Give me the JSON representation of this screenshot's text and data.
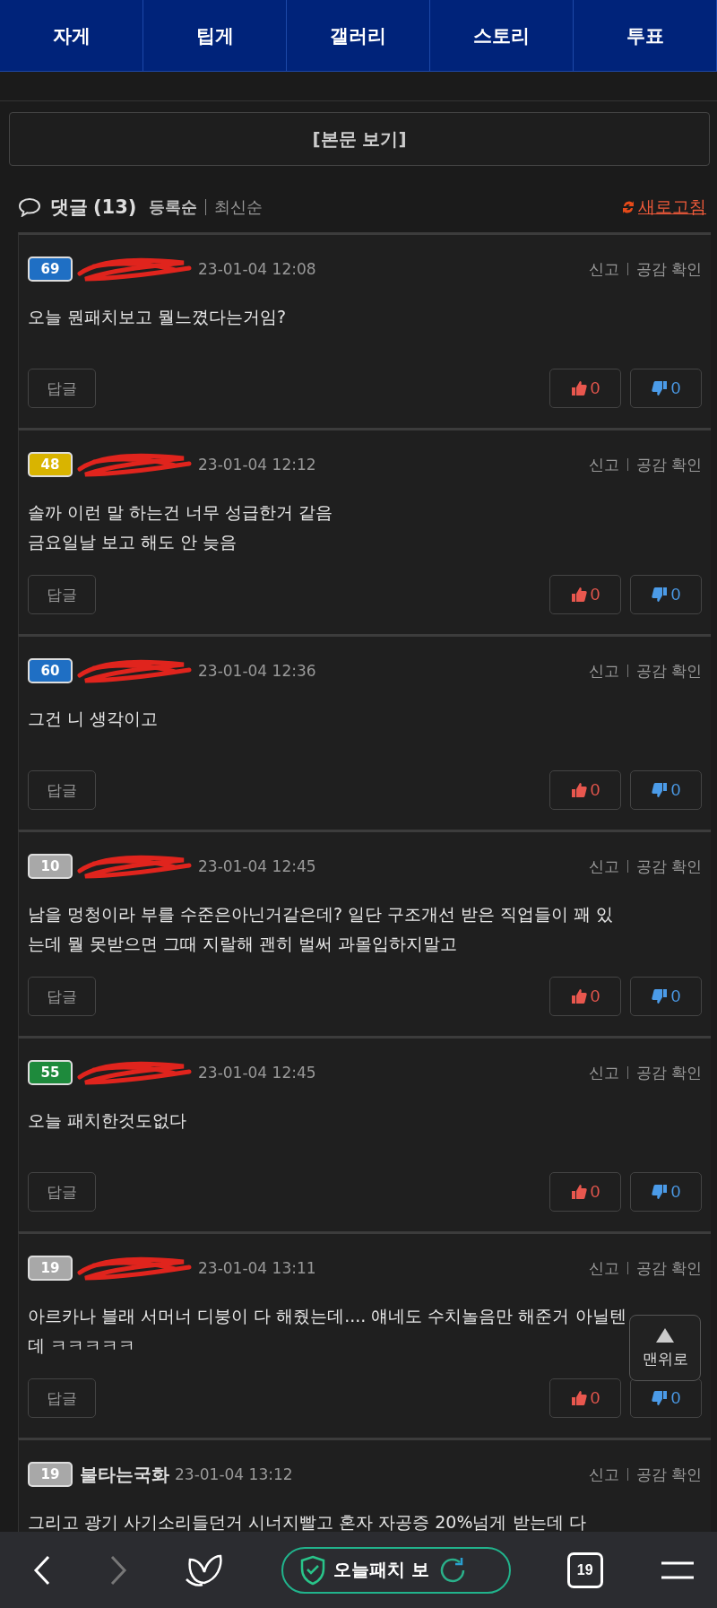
{
  "tabs": [
    {
      "label": "자게",
      "selected": false
    },
    {
      "label": "팁게",
      "selected": false
    },
    {
      "label": "갤러리",
      "selected": false
    },
    {
      "label": "스토리",
      "selected": false
    },
    {
      "label": "투표",
      "selected": false
    }
  ],
  "view_button": "[본문 보기]",
  "comments_header": {
    "title": "댓글",
    "count": "(13)",
    "sorts": [
      {
        "label": "등록순",
        "selected": true
      },
      {
        "label": "최신순",
        "selected": false
      }
    ],
    "refresh": "새로고침"
  },
  "comments": [
    {
      "level": "69",
      "color": "#1f6fc4",
      "redacted": true,
      "date": "23-01-04 12:08",
      "text": "오늘 뭔패치보고 뭘느꼈다는거임?",
      "report": "신고",
      "empathy": "공감 확인",
      "reply": "답글",
      "likes": "0",
      "dislikes": "0"
    },
    {
      "level": "48",
      "color": "#d9b400",
      "redacted": true,
      "date": "23-01-04 12:12",
      "text": "솔까 이런 말 하는건 너무 성급한거 같음\n금요일날 보고 해도 안 늦음",
      "report": "신고",
      "empathy": "공감 확인",
      "reply": "답글",
      "likes": "0",
      "dislikes": "0"
    },
    {
      "level": "60",
      "color": "#1f6fc4",
      "redacted": true,
      "date": "23-01-04 12:36",
      "text": "그건 니 생각이고",
      "report": "신고",
      "empathy": "공감 확인",
      "reply": "답글",
      "likes": "0",
      "dislikes": "0"
    },
    {
      "level": "10",
      "color": "#a8a8a8",
      "redacted": true,
      "date": "23-01-04 12:45",
      "text": "남을 멍청이라 부를 수준은아닌거같은데? 일단 구조개선 받은 직업들이 꽤 있는데 뭘 못받으면 그때 지랄해 괜히 벌써 과몰입하지말고",
      "report": "신고",
      "empathy": "공감 확인",
      "reply": "답글",
      "likes": "0",
      "dislikes": "0"
    },
    {
      "level": "55",
      "color": "#1e8a3c",
      "redacted": true,
      "date": "23-01-04 12:45",
      "text": "오늘 패치한것도없다",
      "report": "신고",
      "empathy": "공감 확인",
      "reply": "답글",
      "likes": "0",
      "dislikes": "0"
    },
    {
      "level": "19",
      "color": "#a8a8a8",
      "redacted": true,
      "date": "23-01-04 13:11",
      "text": "아르카나 블래 서머너 디붕이 다 해줬는데.... 얘네도 수치놀음만 해준거 아닐텐데 ㅋㅋㅋㅋㅋ",
      "report": "신고",
      "empathy": "공감 확인",
      "reply": "답글",
      "likes": "0",
      "dislikes": "0"
    },
    {
      "level": "19",
      "color": "#a8a8a8",
      "name": "불타는국화",
      "redacted": false,
      "date": "23-01-04 13:12",
      "text": "그리고 광기 사기소리들던거 시너지빨고 혼자 자공증 20%넘게 받는데 다",
      "report": "신고",
      "empathy": "공감 확인"
    }
  ],
  "top_button": "맨위로",
  "browser_bar": {
    "address": "오늘패치 보",
    "tab_count": "19"
  }
}
